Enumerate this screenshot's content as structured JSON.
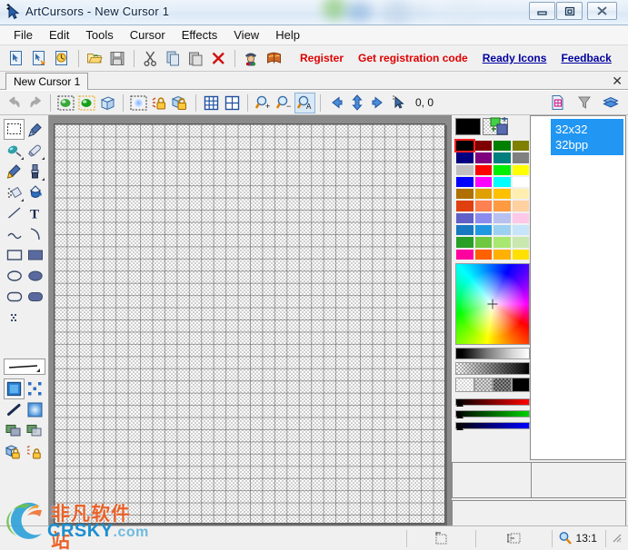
{
  "window": {
    "title": "ArtCursors - New Cursor 1",
    "icon": "cursor-arrow-icon",
    "controls": {
      "minimize": "minimize-icon",
      "maximize": "maximize-icon",
      "close": "close-icon"
    }
  },
  "menu": {
    "items": [
      "File",
      "Edit",
      "Tools",
      "Cursor",
      "Effects",
      "View",
      "Help"
    ]
  },
  "toolbar_main": {
    "buttons": [
      {
        "name": "new-cursor-icon",
        "group": 0
      },
      {
        "name": "new-cursor-from-file-icon",
        "group": 0
      },
      {
        "name": "new-animated-cursor-icon",
        "group": 0
      },
      {
        "name": "open-folder-icon",
        "group": 1
      },
      {
        "name": "save-icon",
        "group": 1
      },
      {
        "name": "cut-icon",
        "group": 2
      },
      {
        "name": "copy-icon",
        "group": 2
      },
      {
        "name": "paste-icon",
        "group": 2
      },
      {
        "name": "delete-icon",
        "group": 2
      },
      {
        "name": "wizard-icon",
        "group": 3
      },
      {
        "name": "library-icon",
        "group": 3
      }
    ],
    "links": [
      {
        "label": "Register",
        "style": "red"
      },
      {
        "label": "Get registration code",
        "style": "red"
      },
      {
        "label": "Ready Icons",
        "style": "blue"
      },
      {
        "label": "Feedback",
        "style": "blue"
      }
    ]
  },
  "tabbar": {
    "tabs": [
      "New Cursor 1"
    ],
    "close_label": "✕"
  },
  "toolbar_secondary": {
    "buttons": [
      {
        "name": "undo-icon",
        "state": "disabled"
      },
      {
        "name": "redo-icon",
        "state": "disabled"
      },
      {
        "name": "select-image-icon",
        "state": "normal"
      },
      {
        "name": "select-image-alt-icon",
        "state": "normal"
      },
      {
        "name": "3d-box-icon",
        "state": "normal"
      },
      {
        "name": "blur-icon",
        "state": "normal"
      },
      {
        "name": "lock-unlock-icon",
        "state": "normal"
      },
      {
        "name": "lock-icon",
        "state": "normal"
      },
      {
        "name": "grid-fine-icon",
        "state": "normal"
      },
      {
        "name": "grid-coarse-icon",
        "state": "normal"
      },
      {
        "name": "zoom-in-icon",
        "state": "normal"
      },
      {
        "name": "zoom-out-icon",
        "state": "normal"
      },
      {
        "name": "zoom-actual-icon",
        "state": "pressed"
      },
      {
        "name": "arrow-left-icon",
        "state": "normal"
      },
      {
        "name": "arrow-updown-icon",
        "state": "normal"
      },
      {
        "name": "arrow-right-icon",
        "state": "normal"
      },
      {
        "name": "hotspot-icon",
        "state": "normal"
      }
    ],
    "hotspot_coord": "0, 0",
    "right_buttons": [
      {
        "name": "new-image-format-icon"
      },
      {
        "name": "delete-image-format-icon"
      },
      {
        "name": "layers-icon"
      }
    ]
  },
  "tool_palette": {
    "tools": [
      {
        "name": "rectangular-select-tool",
        "active": true,
        "dropdown": false
      },
      {
        "name": "color-picker-tool",
        "active": false,
        "dropdown": false
      },
      {
        "name": "airbrush-tool",
        "active": false,
        "dropdown": true
      },
      {
        "name": "eraser-tool",
        "active": false,
        "dropdown": true
      },
      {
        "name": "pencil-tool",
        "active": false,
        "dropdown": false
      },
      {
        "name": "brush-tool",
        "active": false,
        "dropdown": true
      },
      {
        "name": "spray-tool",
        "active": false,
        "dropdown": true
      },
      {
        "name": "paint-bucket-tool",
        "active": false,
        "dropdown": false
      },
      {
        "name": "line-tool",
        "active": false,
        "dropdown": false
      },
      {
        "name": "text-tool",
        "active": false,
        "dropdown": false
      },
      {
        "name": "curve-tool",
        "active": false,
        "dropdown": false
      },
      {
        "name": "arc-tool",
        "active": false,
        "dropdown": false
      },
      {
        "name": "rectangle-tool",
        "active": false,
        "dropdown": false
      },
      {
        "name": "filled-rectangle-tool",
        "active": false,
        "dropdown": false
      },
      {
        "name": "ellipse-tool",
        "active": false,
        "dropdown": false
      },
      {
        "name": "filled-ellipse-tool",
        "active": false,
        "dropdown": false
      },
      {
        "name": "rounded-rectangle-tool",
        "active": false,
        "dropdown": false
      },
      {
        "name": "filled-rounded-rect-tool",
        "active": false,
        "dropdown": false
      },
      {
        "name": "dither-tool",
        "active": false,
        "dropdown": false
      }
    ],
    "line_width_selector": "line-width-icon",
    "options": [
      {
        "name": "fill-style-option",
        "active": true,
        "dropdown": false
      },
      {
        "name": "scatter-option",
        "active": false,
        "dropdown": true
      },
      {
        "name": "stroke-style-option",
        "active": false,
        "dropdown": false
      },
      {
        "name": "gradient-option",
        "active": false,
        "dropdown": true
      },
      {
        "name": "opaque-draw-option",
        "active": false,
        "dropdown": false
      },
      {
        "name": "transparent-draw-option",
        "active": false,
        "dropdown": false
      },
      {
        "name": "lock-shape-option",
        "active": false,
        "dropdown": false
      },
      {
        "name": "lock-color-option",
        "active": false,
        "dropdown": false
      }
    ]
  },
  "canvas": {
    "background": "checkered-transparent",
    "grid_visible": true,
    "zoom": "13:1"
  },
  "color_panel": {
    "foreground_color": "#000000",
    "background_color": "transparent",
    "selected_index": 0,
    "swatches": [
      "#000000",
      "#7f0000",
      "#007f00",
      "#7f7f00",
      "#000080",
      "#7f007f",
      "#007f7f",
      "#808080",
      "#c0c0c0",
      "#ff0000",
      "#00ee00",
      "#ffff00",
      "#0000ff",
      "#ff00ff",
      "#00ffff",
      "#ffffff",
      "#b07000",
      "#e0a000",
      "#ffc000",
      "#ffeeb0",
      "#e04010",
      "#ff8050",
      "#ff9a40",
      "#ffd0a0",
      "#6060c8",
      "#8c8cf0",
      "#b8c0f0",
      "#ffc8e8",
      "#1878c0",
      "#2098e0",
      "#9cd0f0",
      "#c8e4f8",
      "#28a028",
      "#70c840",
      "#a8e870",
      "#c8e8b0",
      "#ff00a0",
      "#ff6000",
      "#ffb000",
      "#ffe000"
    ],
    "alpha_swatches": [
      "25%",
      "50%",
      "75%",
      "100%"
    ],
    "rgb_sliders": [
      {
        "channel": "R",
        "color": "#ff0000"
      },
      {
        "channel": "G",
        "color": "#00d000"
      },
      {
        "channel": "B",
        "color": "#0000ff"
      }
    ]
  },
  "image_list": {
    "items": [
      {
        "size": "32x32",
        "depth": "32bpp",
        "selected": true
      }
    ]
  },
  "statusbar": {
    "hint": "",
    "cursor_size_icon": "image-size-icon",
    "hotspot_status_icon": "hotspot-status-icon",
    "zoom_icon": "magnifier-icon",
    "zoom_level": "13:1"
  },
  "watermark": {
    "chinese": "非凡软件站",
    "domain": "CRSKY",
    "tld": ".com"
  }
}
